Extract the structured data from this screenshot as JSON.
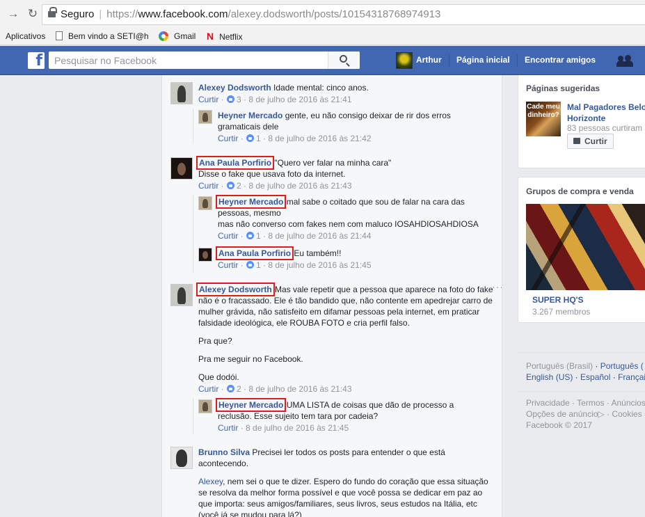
{
  "browser": {
    "secure_label": "Seguro",
    "url_scheme": "https://",
    "url_host": "www.facebook.com",
    "url_path": "/alexey.dodsworth/posts/10154318768974913",
    "bookmarks": [
      "Aplicativos",
      "Bem vindo a SETI@h",
      "Gmail",
      "Netflix"
    ]
  },
  "header": {
    "search_placeholder": "Pesquisar no Facebook",
    "user_name": "Arthur",
    "home": "Página inicial",
    "find_friends": "Encontrar amigos"
  },
  "comments": [
    {
      "author": "Alexey Dodsworth",
      "lines": [
        "Idade mental: cinco anos."
      ],
      "like_label": "Curtir",
      "likes": "3",
      "time": "8 de julho de 2016 às 21:41"
    },
    {
      "author": "Heyner Mercado",
      "lines": [
        "gente, eu não consigo deixar de rir dos erros",
        "gramaticais dele"
      ],
      "like_label": "Curtir",
      "likes": "1",
      "time": "8 de julho de 2016 às 21:42"
    },
    {
      "author": "Ana Paula Porfirio",
      "lines": [
        "\"Quero ver falar na minha cara\"",
        "Disse o fake que usava foto da internet."
      ],
      "like_label": "Curtir",
      "likes": "2",
      "time": "8 de julho de 2016 às 21:43"
    },
    {
      "author": "Heyner Mercado",
      "lines": [
        "mal sabe o coitado que sou de falar na cara das",
        "pessoas, mesmo",
        "mas não converso com fakes nem com maluco IOSAHDIOSAHDIOSA"
      ],
      "like_label": "Curtir",
      "likes": "1",
      "time": "8 de julho de 2016 às 21:44"
    },
    {
      "author": "Ana Paula Porfirio",
      "lines": [
        "Eu também!!"
      ],
      "like_label": "Curtir",
      "likes": "1",
      "time": "8 de julho de 2016 às 21:45"
    },
    {
      "author": "Alexey Dodsworth",
      "lines": [
        "Mas vale repetir que a pessoa que aparece na foto do fake",
        "não é o fracassado. Ele é tão bandido que, não contente em apedrejar carro de",
        "mulher grávida, não satisfeito em difamar pessoas pela internet, em praticar",
        "falsidade ideológica, ele ROUBA FOTO e cria perfil falso."
      ],
      "extra": [
        "Pra que?",
        "Pra me seguir no Facebook.",
        "Que dodói."
      ],
      "like_label": "Curtir",
      "likes": "2",
      "time": "8 de julho de 2016 às 21:43"
    },
    {
      "author": "Heyner Mercado",
      "lines": [
        "UMA LISTA de coisas que dão de processo a",
        "reclusão. Esse sujeito tem tara por cadeia?"
      ],
      "like_label": "Curtir",
      "time": "8 de julho de 2016 às 21:45"
    },
    {
      "author": "Brunno Silva",
      "lines": [
        "Precisei ler todos os posts para entender o que está",
        "acontecendo."
      ],
      "mention": "Alexey",
      "paragraph": [
        ", nem sei o que te dizer. Espero do fundo do coração que essa situação",
        "se resolva da melhor forma possível e que você possa se dedicar em paz ao",
        "que importa: seus amigos/familiares, seus livros, seus estudos na Itália, etc",
        "(você já se mudou para lá?)"
      ]
    }
  ],
  "sidebar": {
    "suggested_title": "Páginas sugeridas",
    "page_name": "Mal Pagadores Belo Horizonte",
    "page_name_l1": "Mal Pagadores Belo",
    "page_name_l2": "Horizonte",
    "page_thumb_text": "Cade meu dinheiro?",
    "page_likes": "83 pessoas curtiram i",
    "like_button": "Curtir",
    "groups_title": "Grupos de compra e venda",
    "group_name": "SUPER HQ'S",
    "group_members": "3.267 membros",
    "languages_l1": [
      "Português (Brasil)",
      "Português (",
      "Português ("
    ],
    "lang_a": "Português (Brasil)",
    "lang_b": "Português (",
    "lang_c": "English (US)",
    "lang_d": "Español",
    "lang_e": "Françai",
    "footer_l1": "Privacidade · Termos · Anúncios",
    "footer_l2": "Opções de anúncio",
    "footer_l2b": "· Cookies",
    "footer_l3": "Facebook © 2017"
  }
}
